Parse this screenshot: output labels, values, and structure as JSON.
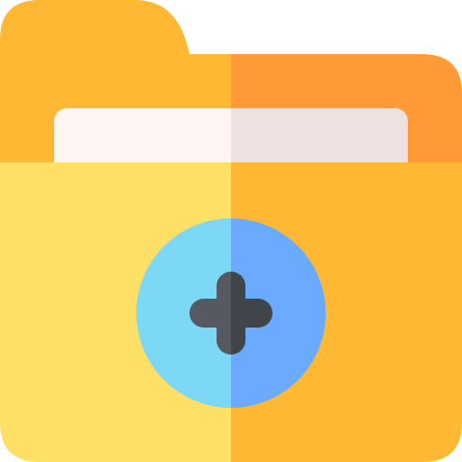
{
  "icon": {
    "name": "add-folder-icon",
    "parts": {
      "folder": "folder-icon",
      "document": "document-sheet",
      "badge": "plus-circle-icon",
      "symbol": "plus-icon"
    },
    "colors": {
      "tab_left": "#FFB833",
      "tab_right": "#FF9A36",
      "paper_left": "#FFF5F2",
      "paper_right": "#EDE2DF",
      "body_left": "#FFE066",
      "body_right": "#FFB833",
      "circle_left": "#7DD8F6",
      "circle_right": "#6AAAFF",
      "plus_left": "#555A62",
      "plus_right": "#3F4549"
    }
  }
}
